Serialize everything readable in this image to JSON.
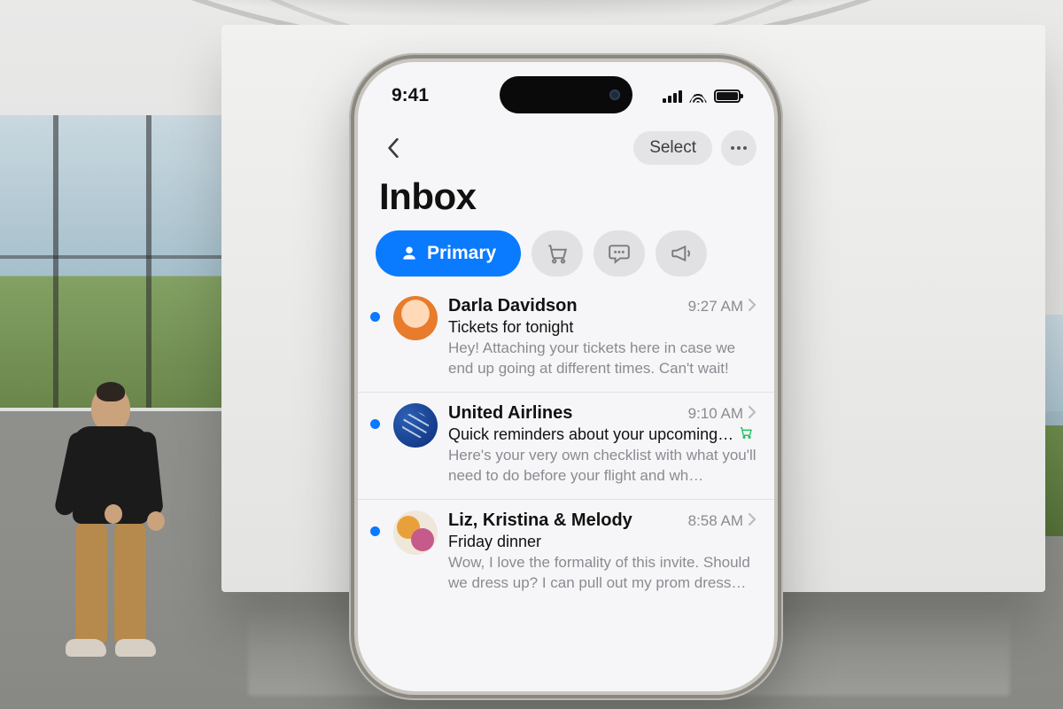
{
  "statusbar": {
    "time": "9:41"
  },
  "nav": {
    "select_label": "Select"
  },
  "title": "Inbox",
  "tabs": {
    "primary_label": "Primary",
    "icons": [
      "shopping-cart-icon",
      "chat-bubble-icon",
      "megaphone-icon"
    ]
  },
  "colors": {
    "accent": "#0a7aff"
  },
  "emails": [
    {
      "sender": "Darla Davidson",
      "time": "9:27 AM",
      "subject": "Tickets for tonight",
      "preview": "Hey! Attaching your tickets here in case we end up going at different times. Can't wait!",
      "unread": true,
      "avatar": "darla"
    },
    {
      "sender": "United Airlines",
      "time": "9:10 AM",
      "subject": "Quick reminders about your upcoming…",
      "preview": "Here's your very own checklist with what you'll need to do before your flight and wh…",
      "unread": true,
      "avatar": "ua",
      "badge": "cart"
    },
    {
      "sender": "Liz, Kristina & Melody",
      "time": "8:58 AM",
      "subject": "Friday dinner",
      "preview": "Wow, I love the formality of this invite. Should we dress up? I can pull out my prom dress…",
      "unread": true,
      "avatar": "group"
    }
  ]
}
